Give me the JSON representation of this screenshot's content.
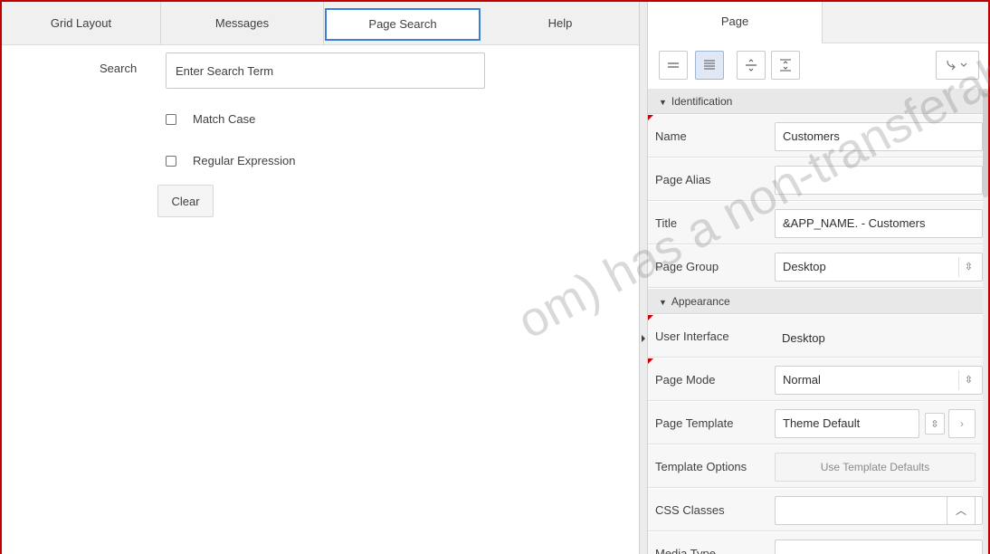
{
  "left_tabs": [
    {
      "label": "Grid Layout",
      "active": false
    },
    {
      "label": "Messages",
      "active": false
    },
    {
      "label": "Page Search",
      "active": true
    },
    {
      "label": "Help",
      "active": false
    }
  ],
  "search": {
    "label": "Search",
    "placeholder": "Enter Search Term",
    "match_case_label": "Match Case",
    "regex_label": "Regular Expression",
    "clear_label": "Clear"
  },
  "right_tabs": {
    "page_label": "Page"
  },
  "toolbar": {
    "buttons": [
      "collapse-all-icon",
      "expand-all-icon",
      "show-common-icon",
      "show-all-icon"
    ],
    "go_to_group_icon": "go-to-group-icon"
  },
  "properties": {
    "identification": {
      "header": "Identification",
      "name_label": "Name",
      "name_value": "Customers",
      "alias_label": "Page Alias",
      "alias_value": "",
      "title_label": "Title",
      "title_value": "&APP_NAME. - Customers",
      "group_label": "Page Group",
      "group_value": "Desktop"
    },
    "appearance": {
      "header": "Appearance",
      "ui_label": "User Interface",
      "ui_value": "Desktop",
      "mode_label": "Page Mode",
      "mode_value": "Normal",
      "template_label": "Page Template",
      "template_value": "Theme Default",
      "template_options_label": "Template Options",
      "template_options_button": "Use Template Defaults",
      "css_label": "CSS Classes",
      "css_value": "",
      "media_label": "Media Type",
      "media_value": ""
    }
  },
  "watermark": "om) has a non-transferable Guide"
}
